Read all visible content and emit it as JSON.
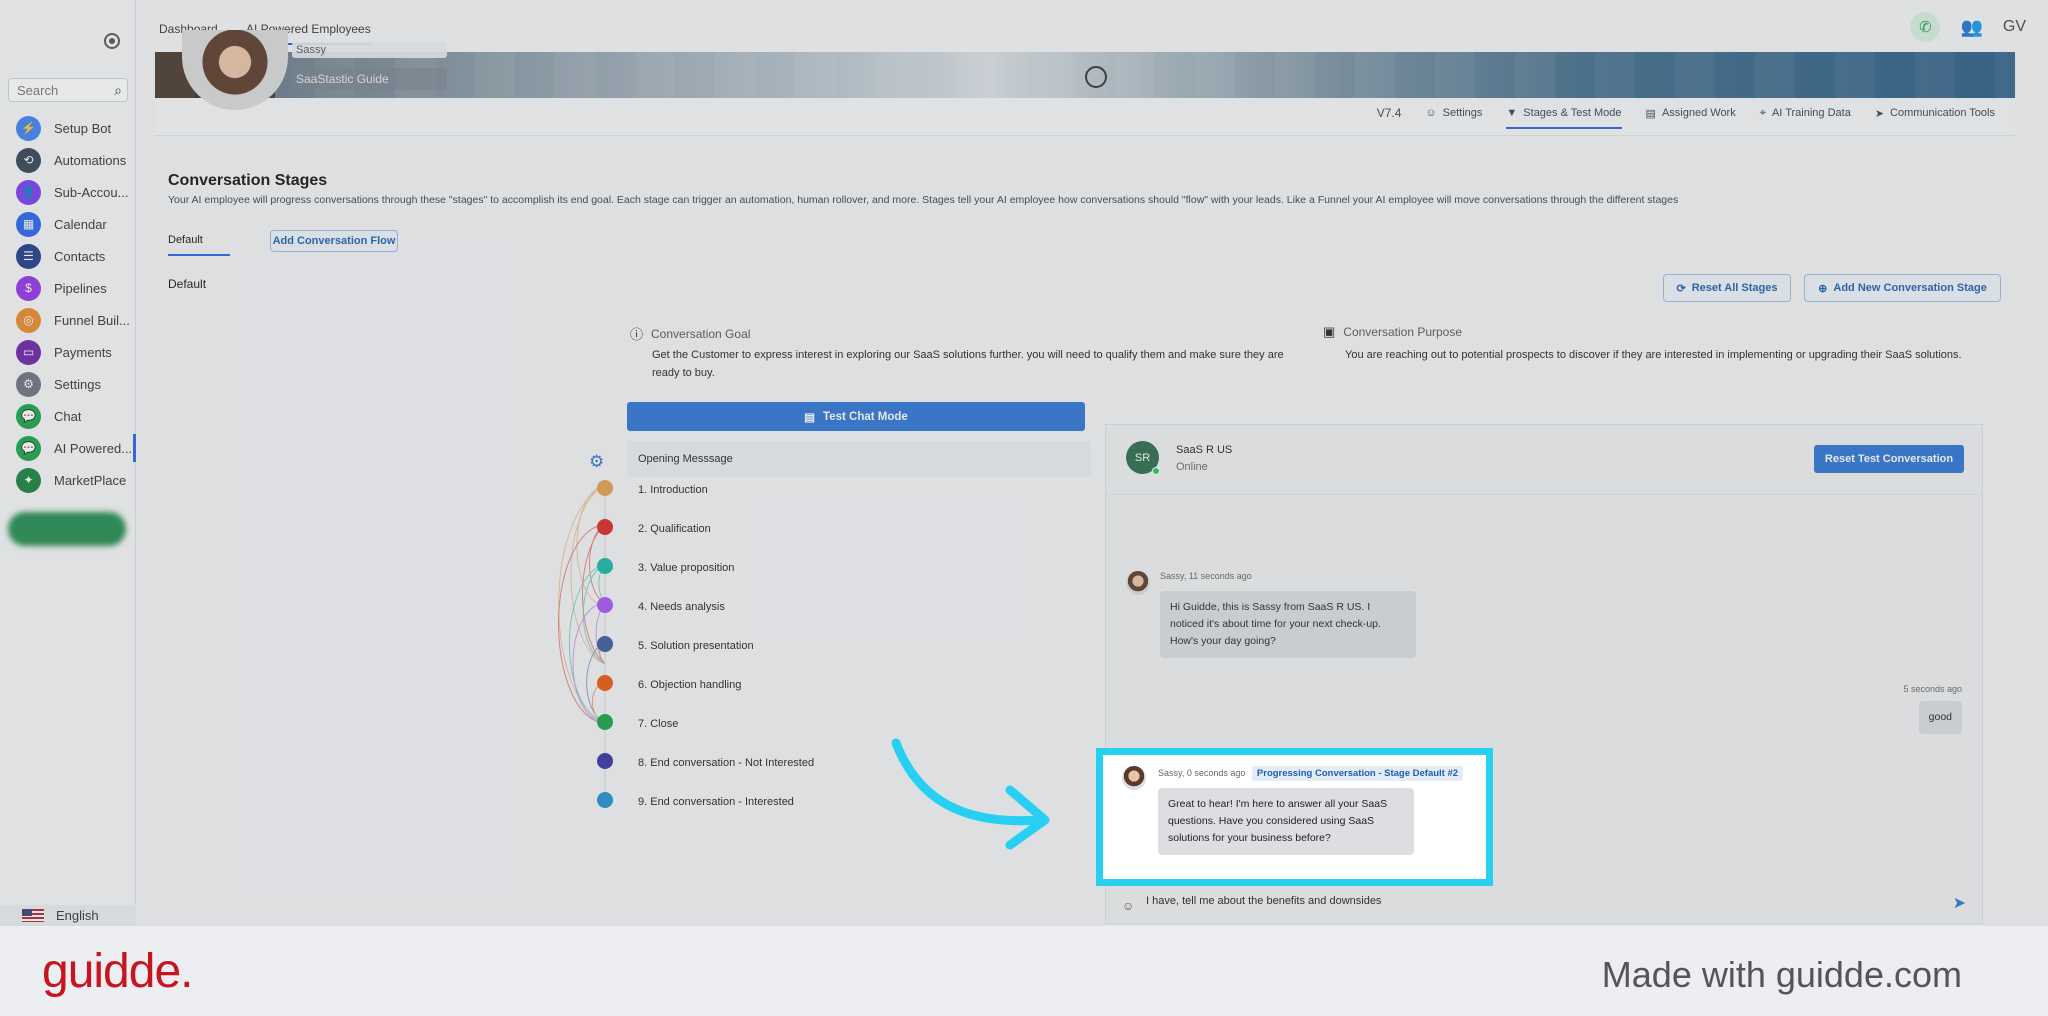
{
  "sidebar": {
    "search_placeholder": "Search",
    "items": [
      {
        "label": "Setup Bot",
        "color": "#3b82f6",
        "icon": "⚡"
      },
      {
        "label": "Automations",
        "color": "#334155",
        "icon": "⟲"
      },
      {
        "label": "Sub-Accou...",
        "color": "#7c3aed",
        "icon": "👤"
      },
      {
        "label": "Calendar",
        "color": "#2563eb",
        "icon": "▦"
      },
      {
        "label": "Contacts",
        "color": "#1e3a8a",
        "icon": "☰"
      },
      {
        "label": "Pipelines",
        "color": "#9333ea",
        "icon": "$"
      },
      {
        "label": "Funnel Buil...",
        "color": "#ea8a2e",
        "icon": "◎"
      },
      {
        "label": "Payments",
        "color": "#6b21a8",
        "icon": "▭"
      },
      {
        "label": "Settings",
        "color": "#6b7280",
        "icon": "⚙"
      },
      {
        "label": "Chat",
        "color": "#16a34a",
        "icon": "💬"
      },
      {
        "label": "AI Powered...",
        "color": "#16a34a",
        "icon": "💬"
      },
      {
        "label": "MarketPlace",
        "color": "#15803d",
        "icon": "✦"
      }
    ],
    "active_index": 10,
    "language": "English"
  },
  "topbar": {
    "crumbs": [
      "Dashboard",
      "AI Powered Employees"
    ],
    "user_initials": "GV"
  },
  "agent": {
    "name": "Sassy",
    "subtitle": "SaaStastic Guide"
  },
  "agent_tabs": {
    "version": "V7.4",
    "tabs": [
      {
        "label": "Settings",
        "icon": "☺"
      },
      {
        "label": "Stages & Test Mode",
        "icon": "▼"
      },
      {
        "label": "Assigned Work",
        "icon": "▤"
      },
      {
        "label": "AI Training Data",
        "icon": "⌖"
      },
      {
        "label": "Communication Tools",
        "icon": "➤"
      }
    ],
    "active_index": 1
  },
  "stages_page": {
    "title": "Conversation Stages",
    "description": "Your AI employee will progress conversations through these \"stages\" to accomplish its end goal. Each stage can trigger an automation, human rollover, and more. Stages tell your AI employee how conversations should \"flow\" with your leads. Like a Funnel your AI employee will move conversations through the different stages",
    "tab_default": "Default",
    "add_flow_label": "Add Conversation Flow",
    "section_label": "Default",
    "reset_all_label": "Reset All Stages",
    "add_stage_label": "Add New Conversation Stage",
    "goal_title": "Conversation Goal",
    "goal_text": "Get the Customer to express interest in exploring our SaaS solutions further. you will need to qualify them and make sure they are ready to buy.",
    "purpose_title": "Conversation Purpose",
    "purpose_text": "You are reaching out to potential prospects to discover if they are interested in implementing or upgrading their SaaS solutions.",
    "test_chat_label": "Test Chat Mode",
    "opening_label": "Opening Messsage",
    "stages": [
      {
        "label": "1. Introduction",
        "color": "#e0a050"
      },
      {
        "label": "2. Qualification",
        "color": "#dc2626"
      },
      {
        "label": "3. Value proposition",
        "color": "#14b8a6"
      },
      {
        "label": "4. Needs analysis",
        "color": "#a855f7"
      },
      {
        "label": "5. Solution presentation",
        "color": "#3b5b9a"
      },
      {
        "label": "6. Objection handling",
        "color": "#ea580c"
      },
      {
        "label": "7. Close",
        "color": "#16a34a"
      },
      {
        "label": "8. End conversation - Not Interested",
        "color": "#3730a3"
      },
      {
        "label": "9. End conversation - Interested",
        "color": "#1d8fd0"
      }
    ]
  },
  "chat": {
    "avatar_initials": "SR",
    "contact_name": "SaaS R US",
    "status": "Online",
    "reset_label": "Reset Test Conversation",
    "msg1_meta": "Sassy, 11 seconds ago",
    "msg1_text": "Hi Guidde, this is Sassy from SaaS R US. I noticed it's about time for your next check-up. How's your day going?",
    "msg2_meta": "5 seconds ago",
    "msg2_text": "good",
    "msg3_meta": "Sassy, 0 seconds ago",
    "msg3_badge": "Progressing Conversation - Stage Default #2",
    "msg3_text": "Great to hear! I'm here to answer all your SaaS questions. Have you considered using SaaS solutions for your business before?",
    "input_value": "I have, tell me about the benefits and downsides"
  },
  "footer": {
    "logo": "guidde.",
    "made_with": "Made with guidde.com"
  },
  "colors": {
    "accent": "#2d74d6",
    "highlight": "#27d0f2",
    "brand": "#c8141e"
  }
}
